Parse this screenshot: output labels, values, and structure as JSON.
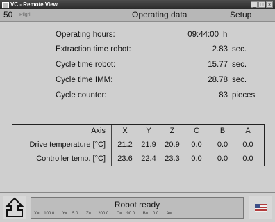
{
  "window": {
    "title": "VC - Remote View",
    "controls": [
      "_",
      "□",
      "×"
    ]
  },
  "header": {
    "number": "50",
    "sub_label": "Pilgri",
    "title": "Operating data",
    "setup_label": "Setup"
  },
  "operating": [
    {
      "label": "Operating hours:",
      "value": "09:44:00",
      "unit": "h"
    },
    {
      "label": "Extraction time robot:",
      "value": "2.83",
      "unit": "sec."
    },
    {
      "label": "Cycle time robot:",
      "value": "15.77",
      "unit": "sec."
    },
    {
      "label": "Cycle time IMM:",
      "value": "28.78",
      "unit": "sec."
    },
    {
      "label": "Cycle counter:",
      "value": "83",
      "unit": "pieces"
    }
  ],
  "axis_table": {
    "header_label": "Axis",
    "axes": [
      "X",
      "Y",
      "Z",
      "C",
      "B",
      "A"
    ],
    "rows": [
      {
        "label": "Drive temperature [°C]",
        "values": [
          "21.2",
          "21.9",
          "20.9",
          "0.0",
          "0.0",
          "0.0"
        ]
      },
      {
        "label": "Controller temp. [°C]",
        "values": [
          "23.6",
          "22.4",
          "23.3",
          "0.0",
          "0.0",
          "0.0"
        ]
      }
    ]
  },
  "footer": {
    "status": "Robot ready",
    "coords": [
      {
        "label": "X=",
        "value": "100.0"
      },
      {
        "label": "Y=",
        "value": "5.0"
      },
      {
        "label": "Z=",
        "value": "1200.0"
      },
      {
        "label": "C=",
        "value": "90.0"
      },
      {
        "label": "B=",
        "value": "0.0"
      },
      {
        "label": "A=",
        "value": ""
      }
    ]
  },
  "icons": {
    "home": "home-icon",
    "flag": "language-flag-icon",
    "app": "app-icon"
  }
}
